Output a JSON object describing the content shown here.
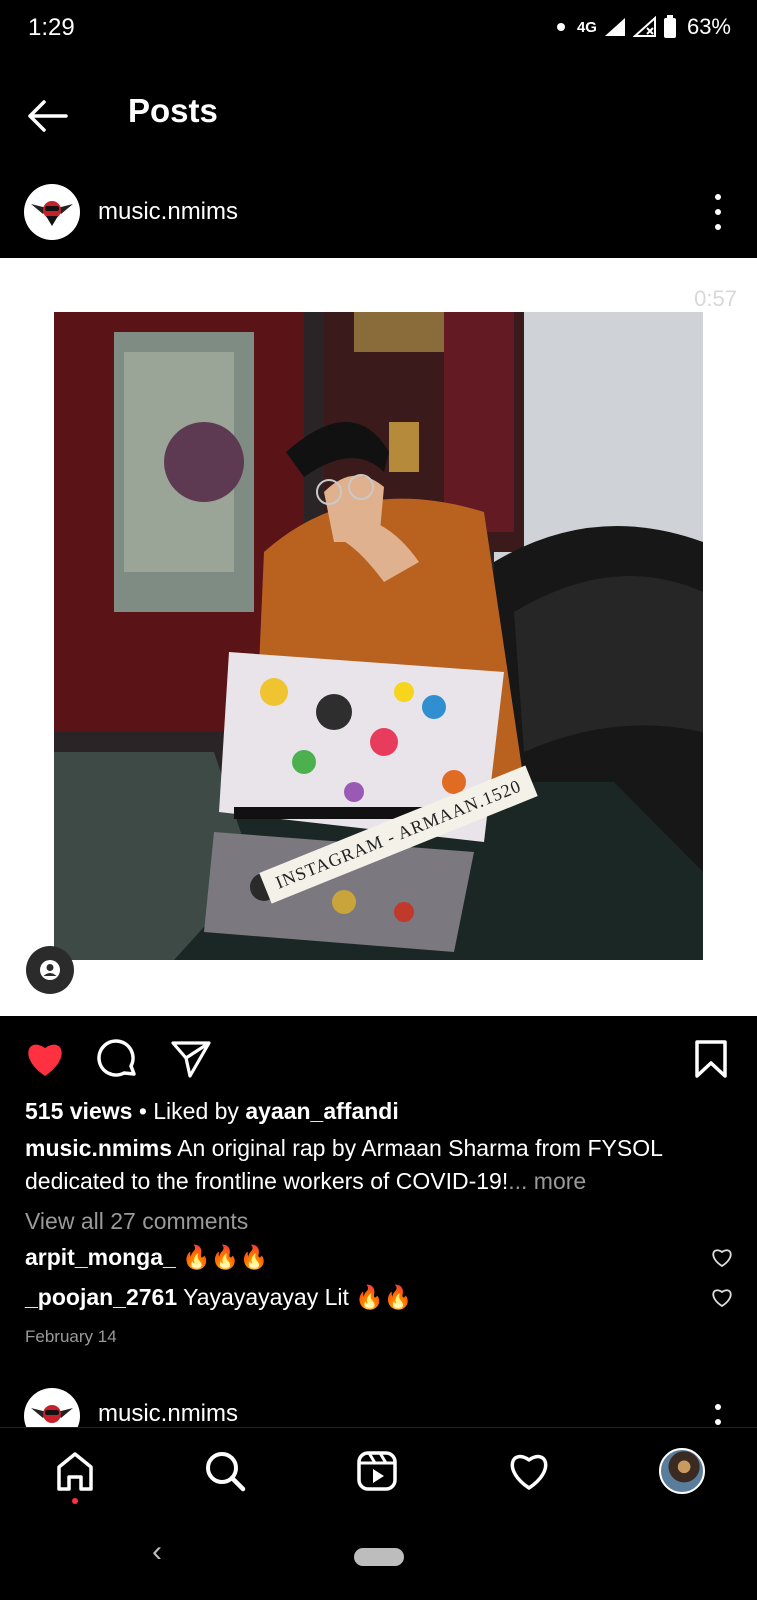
{
  "status_bar": {
    "time": "1:29",
    "network": "4G",
    "battery": "63%"
  },
  "header": {
    "title": "Posts",
    "back_icon": "arrow-left-icon"
  },
  "post": {
    "username": "music.nmims",
    "video_timer": "0:57",
    "watermark": "INSTAGRAM - ARMAAN.1520",
    "views": "515 views",
    "liked_by_prefix": "Liked by ",
    "liked_by_user": "ayaan_affandi",
    "caption_user": "music.nmims",
    "caption_text": "An original rap by Armaan Sharma from FYSOL dedicated to the frontline workers of COVID-19!",
    "caption_more": "... more",
    "view_comments": "View all 27 comments",
    "comments": [
      {
        "user": "arpit_monga_",
        "text": "🔥🔥🔥"
      },
      {
        "user": "_poojan_2761",
        "text": "Yayayayayay Lit 🔥🔥"
      }
    ],
    "date": "February 14",
    "liked": true,
    "like_color": "#ff3040"
  },
  "next_post": {
    "username": "music.nmims"
  },
  "bottom_nav": {
    "items": [
      "home-icon",
      "search-icon",
      "reels-icon",
      "activity-heart-icon",
      "profile-avatar"
    ]
  }
}
